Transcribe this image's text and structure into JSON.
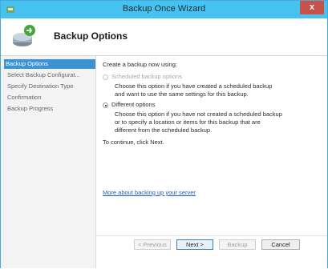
{
  "window": {
    "title": "Backup Once Wizard",
    "close_label": "x",
    "accent": "#45c2f0"
  },
  "header": {
    "title": "Backup Options",
    "icon": "backup-icon"
  },
  "sidebar": {
    "items": [
      {
        "label": "Backup Options",
        "active": true
      },
      {
        "label": "Select Backup Configurat...",
        "active": false
      },
      {
        "label": "Specify Destination Type",
        "active": false
      },
      {
        "label": "Confirmation",
        "active": false
      },
      {
        "label": "Backup Progress",
        "active": false
      }
    ]
  },
  "main": {
    "prompt": "Create a backup now using:",
    "options": [
      {
        "label": "Scheduled backup options",
        "desc_lines": [
          "Choose this option if you have created a scheduled backup",
          "and want to use the same settings for this backup."
        ],
        "checked": false,
        "disabled": true
      },
      {
        "label": "Different options",
        "desc_lines": [
          "Choose this option if you have not created a scheduled backup",
          "or to specify a location or items for this backup that are",
          "different from the scheduled backup."
        ],
        "checked": true,
        "disabled": false
      }
    ],
    "continue_text": "To continue, click Next.",
    "more_link": "More about backing up your server"
  },
  "footer": {
    "previous_label": "< Previous",
    "next_label": "Next >",
    "backup_label": "Backup",
    "cancel_label": "Cancel"
  }
}
